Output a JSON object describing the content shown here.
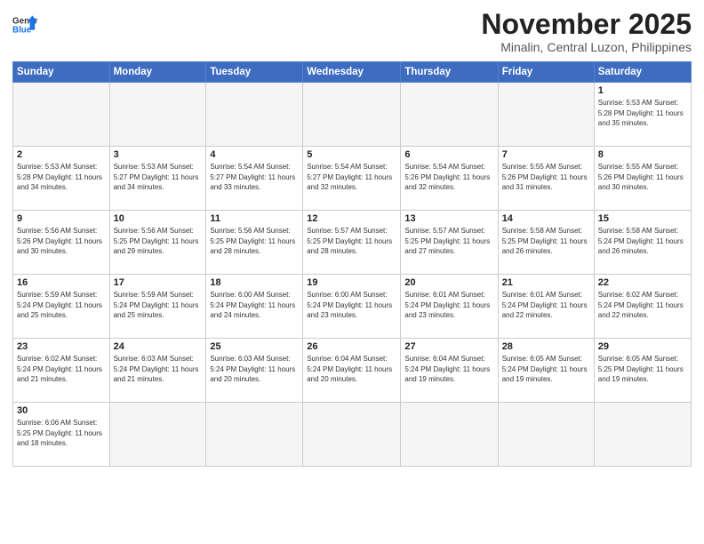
{
  "logo": {
    "line1": "General",
    "line2": "Blue"
  },
  "header": {
    "month": "November 2025",
    "location": "Minalin, Central Luzon, Philippines"
  },
  "weekdays": [
    "Sunday",
    "Monday",
    "Tuesday",
    "Wednesday",
    "Thursday",
    "Friday",
    "Saturday"
  ],
  "weeks": [
    [
      {
        "day": "",
        "info": ""
      },
      {
        "day": "",
        "info": ""
      },
      {
        "day": "",
        "info": ""
      },
      {
        "day": "",
        "info": ""
      },
      {
        "day": "",
        "info": ""
      },
      {
        "day": "",
        "info": ""
      },
      {
        "day": "1",
        "info": "Sunrise: 5:53 AM\nSunset: 5:28 PM\nDaylight: 11 hours and 35 minutes."
      }
    ],
    [
      {
        "day": "2",
        "info": "Sunrise: 5:53 AM\nSunset: 5:28 PM\nDaylight: 11 hours and 34 minutes."
      },
      {
        "day": "3",
        "info": "Sunrise: 5:53 AM\nSunset: 5:27 PM\nDaylight: 11 hours and 34 minutes."
      },
      {
        "day": "4",
        "info": "Sunrise: 5:54 AM\nSunset: 5:27 PM\nDaylight: 11 hours and 33 minutes."
      },
      {
        "day": "5",
        "info": "Sunrise: 5:54 AM\nSunset: 5:27 PM\nDaylight: 11 hours and 32 minutes."
      },
      {
        "day": "6",
        "info": "Sunrise: 5:54 AM\nSunset: 5:26 PM\nDaylight: 11 hours and 32 minutes."
      },
      {
        "day": "7",
        "info": "Sunrise: 5:55 AM\nSunset: 5:26 PM\nDaylight: 11 hours and 31 minutes."
      },
      {
        "day": "8",
        "info": "Sunrise: 5:55 AM\nSunset: 5:26 PM\nDaylight: 11 hours and 30 minutes."
      }
    ],
    [
      {
        "day": "9",
        "info": "Sunrise: 5:56 AM\nSunset: 5:26 PM\nDaylight: 11 hours and 30 minutes."
      },
      {
        "day": "10",
        "info": "Sunrise: 5:56 AM\nSunset: 5:25 PM\nDaylight: 11 hours and 29 minutes."
      },
      {
        "day": "11",
        "info": "Sunrise: 5:56 AM\nSunset: 5:25 PM\nDaylight: 11 hours and 28 minutes."
      },
      {
        "day": "12",
        "info": "Sunrise: 5:57 AM\nSunset: 5:25 PM\nDaylight: 11 hours and 28 minutes."
      },
      {
        "day": "13",
        "info": "Sunrise: 5:57 AM\nSunset: 5:25 PM\nDaylight: 11 hours and 27 minutes."
      },
      {
        "day": "14",
        "info": "Sunrise: 5:58 AM\nSunset: 5:25 PM\nDaylight: 11 hours and 26 minutes."
      },
      {
        "day": "15",
        "info": "Sunrise: 5:58 AM\nSunset: 5:24 PM\nDaylight: 11 hours and 26 minutes."
      }
    ],
    [
      {
        "day": "16",
        "info": "Sunrise: 5:59 AM\nSunset: 5:24 PM\nDaylight: 11 hours and 25 minutes."
      },
      {
        "day": "17",
        "info": "Sunrise: 5:59 AM\nSunset: 5:24 PM\nDaylight: 11 hours and 25 minutes."
      },
      {
        "day": "18",
        "info": "Sunrise: 6:00 AM\nSunset: 5:24 PM\nDaylight: 11 hours and 24 minutes."
      },
      {
        "day": "19",
        "info": "Sunrise: 6:00 AM\nSunset: 5:24 PM\nDaylight: 11 hours and 23 minutes."
      },
      {
        "day": "20",
        "info": "Sunrise: 6:01 AM\nSunset: 5:24 PM\nDaylight: 11 hours and 23 minutes."
      },
      {
        "day": "21",
        "info": "Sunrise: 6:01 AM\nSunset: 5:24 PM\nDaylight: 11 hours and 22 minutes."
      },
      {
        "day": "22",
        "info": "Sunrise: 6:02 AM\nSunset: 5:24 PM\nDaylight: 11 hours and 22 minutes."
      }
    ],
    [
      {
        "day": "23",
        "info": "Sunrise: 6:02 AM\nSunset: 5:24 PM\nDaylight: 11 hours and 21 minutes."
      },
      {
        "day": "24",
        "info": "Sunrise: 6:03 AM\nSunset: 5:24 PM\nDaylight: 11 hours and 21 minutes."
      },
      {
        "day": "25",
        "info": "Sunrise: 6:03 AM\nSunset: 5:24 PM\nDaylight: 11 hours and 20 minutes."
      },
      {
        "day": "26",
        "info": "Sunrise: 6:04 AM\nSunset: 5:24 PM\nDaylight: 11 hours and 20 minutes."
      },
      {
        "day": "27",
        "info": "Sunrise: 6:04 AM\nSunset: 5:24 PM\nDaylight: 11 hours and 19 minutes."
      },
      {
        "day": "28",
        "info": "Sunrise: 6:05 AM\nSunset: 5:24 PM\nDaylight: 11 hours and 19 minutes."
      },
      {
        "day": "29",
        "info": "Sunrise: 6:05 AM\nSunset: 5:25 PM\nDaylight: 11 hours and 19 minutes."
      }
    ],
    [
      {
        "day": "30",
        "info": "Sunrise: 6:06 AM\nSunset: 5:25 PM\nDaylight: 11 hours and 18 minutes."
      },
      {
        "day": "",
        "info": ""
      },
      {
        "day": "",
        "info": ""
      },
      {
        "day": "",
        "info": ""
      },
      {
        "day": "",
        "info": ""
      },
      {
        "day": "",
        "info": ""
      },
      {
        "day": "",
        "info": ""
      }
    ]
  ]
}
